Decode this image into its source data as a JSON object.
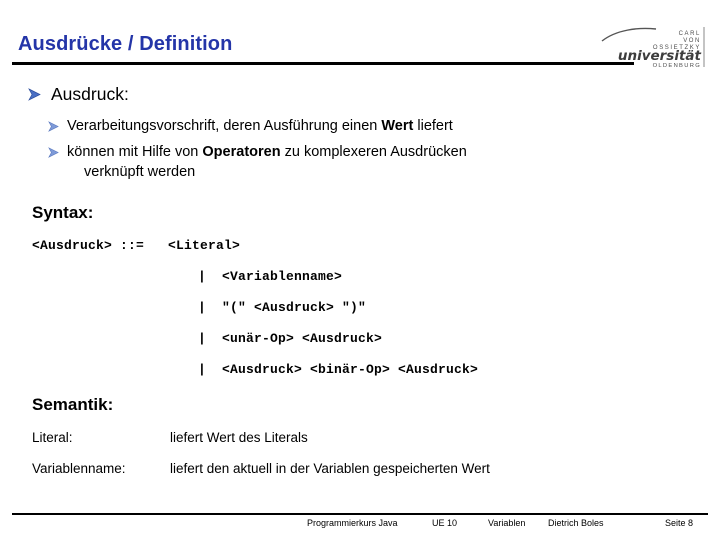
{
  "slide": {
    "title": "Ausdrücke / Definition",
    "title_color": "#2435a8"
  },
  "logo": {
    "line1": "CARL",
    "line2": "VON",
    "line3": "OSSIETZKY",
    "wordmark": "universität",
    "city": "OLDENBURG"
  },
  "bullets": {
    "level1": {
      "bullet_glyph": "arrow-bullet",
      "text": "Ausdruck:"
    },
    "level2": [
      {
        "bullet_glyph": "arrow-bullet",
        "parts": [
          {
            "text": "Verarbeitungsvorschrift, deren Ausführung einen ",
            "bold": false
          },
          {
            "text": "Wert",
            "bold": true
          },
          {
            "text": " liefert",
            "bold": false
          }
        ],
        "plain": "Verarbeitungsvorschrift, deren Ausführung einen Wert liefert"
      },
      {
        "bullet_glyph": "arrow-bullet",
        "parts": [
          {
            "text": "können mit Hilfe von ",
            "bold": false
          },
          {
            "text": "Operatoren",
            "bold": true
          },
          {
            "text": " zu komplexeren Ausdrücken",
            "bold": false
          }
        ],
        "plain": "können mit Hilfe von Operatoren zu komplexeren Ausdrücken",
        "continuation": "verknüpft werden"
      }
    ]
  },
  "syntax": {
    "heading": "Syntax:",
    "lines": [
      "<Ausdruck> ::=   <Literal>",
      "|  <Variablenname>",
      "|  \"(\" <Ausdruck> \")\"",
      "|  <unär-Op> <Ausdruck>",
      "|  <Ausdruck> <binär-Op> <Ausdruck>"
    ]
  },
  "semantik": {
    "heading": "Semantik:",
    "rows": [
      {
        "term": "Literal:",
        "description": "liefert Wert des Literals"
      },
      {
        "term": "Variablenname:",
        "description": "liefert den aktuell in der Variablen gespeicherten Wert"
      }
    ]
  },
  "footer": {
    "items": [
      "Programmierkurs Java",
      "UE 10",
      "Variablen",
      "Dietrich Boles",
      "Seite 8"
    ]
  }
}
